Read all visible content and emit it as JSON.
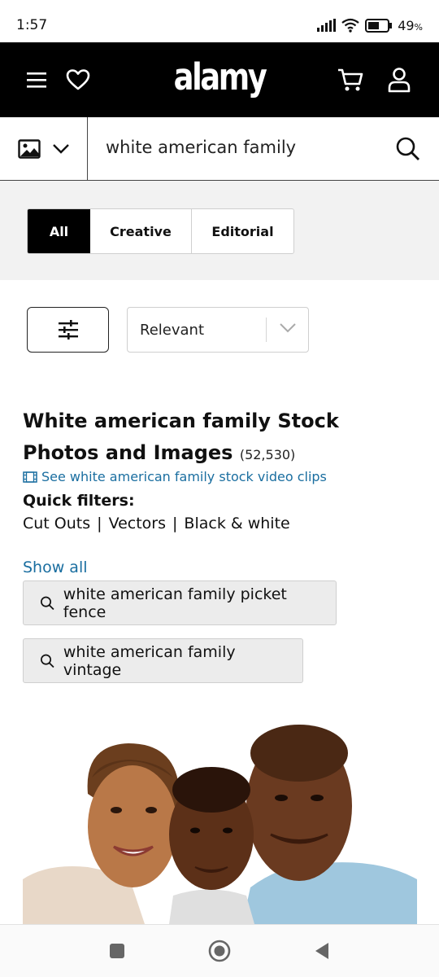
{
  "status_bar": {
    "time": "1:57",
    "battery": "49",
    "battery_unit": "%"
  },
  "header": {
    "logo": "alamy"
  },
  "search": {
    "query": "white american family"
  },
  "segments": [
    {
      "label": "All",
      "active": true
    },
    {
      "label": "Creative",
      "active": false
    },
    {
      "label": "Editorial",
      "active": false
    }
  ],
  "sort": {
    "selected": "Relevant"
  },
  "results": {
    "title": "White american family Stock Photos and Images",
    "count": "(52,530)",
    "video_link": "See white american family stock video clips"
  },
  "quick_filters": {
    "label": "Quick filters:",
    "items": [
      "Cut Outs",
      "Vectors",
      "Black & white"
    ],
    "separator": "|"
  },
  "suggestions": {
    "show_all": "Show all",
    "items": [
      "white american family picket fence",
      "white american family vintage"
    ]
  },
  "colors": {
    "header_bg": "#000000",
    "link": "#1a6ea0",
    "segment_active": "#000000"
  }
}
